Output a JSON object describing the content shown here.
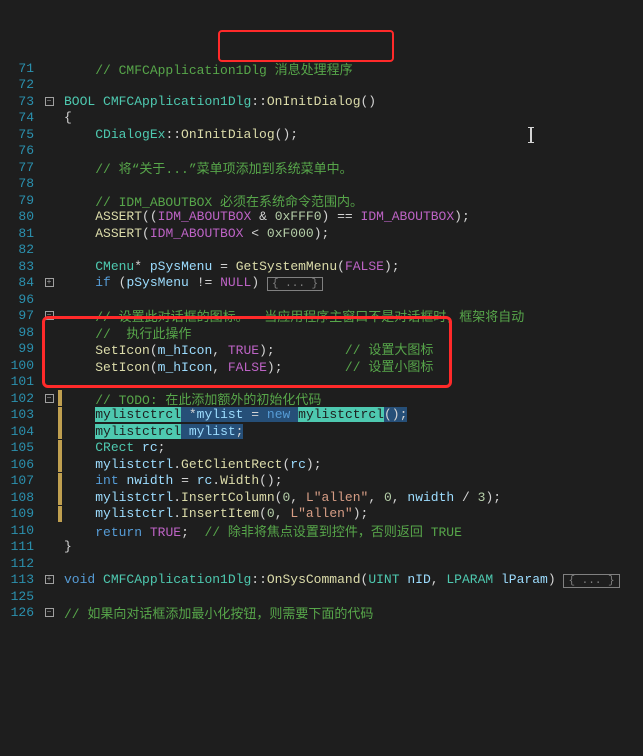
{
  "lines": [
    {
      "num": "71",
      "fold": "",
      "mark": false,
      "html": "    <span class='c-comment'>// CMFCApplication1Dlg 消息处理程序</span>"
    },
    {
      "num": "72",
      "fold": "",
      "mark": false,
      "html": ""
    },
    {
      "num": "73",
      "fold": "minus",
      "mark": false,
      "html": "<span class='c-type'>BOOL</span> <span class='c-type'>CMFCApplication1Dlg</span><span class='c-punct'>::</span><span class='c-func'>OnInitDialog</span><span class='c-punct'>()</span>"
    },
    {
      "num": "74",
      "fold": "",
      "mark": false,
      "html": "<span class='c-punct'>{</span>"
    },
    {
      "num": "75",
      "fold": "",
      "mark": false,
      "html": "    <span class='c-type'>CDialogEx</span><span class='c-punct'>::</span><span class='c-func'>OnInitDialog</span><span class='c-punct'>();</span>"
    },
    {
      "num": "76",
      "fold": "",
      "mark": false,
      "html": ""
    },
    {
      "num": "77",
      "fold": "",
      "mark": false,
      "html": "    <span class='c-comment'>// 将“关于...”菜单项添加到系统菜单中。</span>"
    },
    {
      "num": "78",
      "fold": "",
      "mark": false,
      "html": ""
    },
    {
      "num": "79",
      "fold": "",
      "mark": false,
      "html": "    <span class='c-comment'>// IDM_ABOUTBOX 必须在系统命令范围内。</span>"
    },
    {
      "num": "80",
      "fold": "",
      "mark": false,
      "html": "    <span class='c-func'>ASSERT</span><span class='c-punct'>((</span><span class='c-macro'>IDM_ABOUTBOX</span> <span class='c-punct'>&amp;</span> <span class='c-number'>0xFFF0</span><span class='c-punct'>) ==</span> <span class='c-macro'>IDM_ABOUTBOX</span><span class='c-punct'>);</span>"
    },
    {
      "num": "81",
      "fold": "",
      "mark": false,
      "html": "    <span class='c-func'>ASSERT</span><span class='c-punct'>(</span><span class='c-macro'>IDM_ABOUTBOX</span> <span class='c-punct'>&lt;</span> <span class='c-number'>0xF000</span><span class='c-punct'>);</span>"
    },
    {
      "num": "82",
      "fold": "",
      "mark": false,
      "html": ""
    },
    {
      "num": "83",
      "fold": "",
      "mark": false,
      "html": "    <span class='c-type'>CMenu</span><span class='c-punct'>*</span> <span class='c-param'>pSysMenu</span> <span class='c-punct'>=</span> <span class='c-func'>GetSystemMenu</span><span class='c-punct'>(</span><span class='c-macro'>FALSE</span><span class='c-punct'>);</span>"
    },
    {
      "num": "84",
      "fold": "plus",
      "mark": false,
      "html": "    <span class='c-keyword'>if</span> <span class='c-punct'>(</span><span class='c-param'>pSysMenu</span> <span class='c-punct'>!=</span> <span class='c-macro'>NULL</span><span class='c-punct'>)</span> <span class='folded-region'>{ ... }</span>"
    },
    {
      "num": "96",
      "fold": "",
      "mark": false,
      "html": ""
    },
    {
      "num": "97",
      "fold": "minus",
      "mark": false,
      "html": "    <span class='c-comment'>// 设置此对话框的图标。  当应用程序主窗口不是对话框时，框架将自动</span>"
    },
    {
      "num": "98",
      "fold": "",
      "mark": false,
      "html": "    <span class='c-comment'>//  执行此操作</span>"
    },
    {
      "num": "99",
      "fold": "",
      "mark": false,
      "html": "    <span class='c-func'>SetIcon</span><span class='c-punct'>(</span><span class='c-param'>m_hIcon</span><span class='c-punct'>,</span> <span class='c-macro'>TRUE</span><span class='c-punct'>);</span>         <span class='c-comment'>// 设置大图标</span>"
    },
    {
      "num": "100",
      "fold": "",
      "mark": false,
      "html": "    <span class='c-func'>SetIcon</span><span class='c-punct'>(</span><span class='c-param'>m_hIcon</span><span class='c-punct'>,</span> <span class='c-macro'>FALSE</span><span class='c-punct'>);</span>        <span class='c-comment'>// 设置小图标</span>"
    },
    {
      "num": "101",
      "fold": "",
      "mark": false,
      "html": ""
    },
    {
      "num": "102",
      "fold": "minus",
      "mark": true,
      "html": "    <span class='c-comment'>// TODO: 在此添加额外的初始化代码</span>"
    },
    {
      "num": "103",
      "fold": "",
      "mark": true,
      "html": "    <span class='sel'><span class='sel-type'>mylistctrcl</span> <span class='c-punct'>*</span><span class='c-param'>mylist</span> <span class='c-punct'>=</span> <span class='c-keyword'>new</span> <span class='sel-type'>mylistctrcl</span><span class='c-punct'>();</span></span>"
    },
    {
      "num": "104",
      "fold": "",
      "mark": true,
      "html": "    <span class='sel'><span class='sel-type'>mylistctrcl</span> <span class='c-param'>mylist</span><span class='c-punct'>;</span></span>"
    },
    {
      "num": "105",
      "fold": "",
      "mark": true,
      "html": "    <span class='c-type'>CRect</span> <span class='c-param'>rc</span><span class='c-punct'>;</span>"
    },
    {
      "num": "106",
      "fold": "",
      "mark": true,
      "html": "    <span class='c-param'>mylistctrl</span><span class='c-punct'>.</span><span class='c-func'>GetClientRect</span><span class='c-punct'>(</span><span class='c-param'>rc</span><span class='c-punct'>);</span>"
    },
    {
      "num": "107",
      "fold": "",
      "mark": true,
      "html": "    <span class='c-keyword'>int</span> <span class='c-param'>nwidth</span> <span class='c-punct'>=</span> <span class='c-param'>rc</span><span class='c-punct'>.</span><span class='c-func'>Width</span><span class='c-punct'>();</span>"
    },
    {
      "num": "108",
      "fold": "",
      "mark": true,
      "html": "    <span class='c-param'>mylistctrl</span><span class='c-punct'>.</span><span class='c-func'>InsertColumn</span><span class='c-punct'>(</span><span class='c-number'>0</span><span class='c-punct'>,</span> <span class='c-string'>L\"allen\"</span><span class='c-punct'>,</span> <span class='c-number'>0</span><span class='c-punct'>,</span> <span class='c-param'>nwidth</span> <span class='c-punct'>/</span> <span class='c-number'>3</span><span class='c-punct'>);</span>"
    },
    {
      "num": "109",
      "fold": "",
      "mark": true,
      "html": "    <span class='c-param'>mylistctrl</span><span class='c-punct'>.</span><span class='c-func'>InsertItem</span><span class='c-punct'>(</span><span class='c-number'>0</span><span class='c-punct'>,</span> <span class='c-string'>L\"allen\"</span><span class='c-punct'>);</span>"
    },
    {
      "num": "110",
      "fold": "",
      "mark": false,
      "html": "    <span class='c-keyword'>return</span> <span class='c-macro'>TRUE</span><span class='c-punct'>;</span>  <span class='c-comment'>// 除非将焦点设置到控件，否则返回 TRUE</span>"
    },
    {
      "num": "111",
      "fold": "",
      "mark": false,
      "html": "<span class='c-punct'>}</span>"
    },
    {
      "num": "112",
      "fold": "",
      "mark": false,
      "html": ""
    },
    {
      "num": "113",
      "fold": "plus",
      "mark": false,
      "html": "<span class='c-keyword'>void</span> <span class='c-type'>CMFCApplication1Dlg</span><span class='c-punct'>::</span><span class='c-func'>OnSysCommand</span><span class='c-punct'>(</span><span class='c-type'>UINT</span> <span class='c-param'>nID</span><span class='c-punct'>,</span> <span class='c-type'>LPARAM</span> <span class='c-param'>lParam</span><span class='c-punct'>)</span> <span class='folded-region'>{ ... }</span>"
    },
    {
      "num": "125",
      "fold": "",
      "mark": false,
      "html": ""
    },
    {
      "num": "126",
      "fold": "minus",
      "mark": false,
      "html": "<span class='c-comment'>// 如果向对话框添加最小化按钮，则需要下面的代码</span>"
    }
  ],
  "fold_plus": "+",
  "fold_minus": "−"
}
